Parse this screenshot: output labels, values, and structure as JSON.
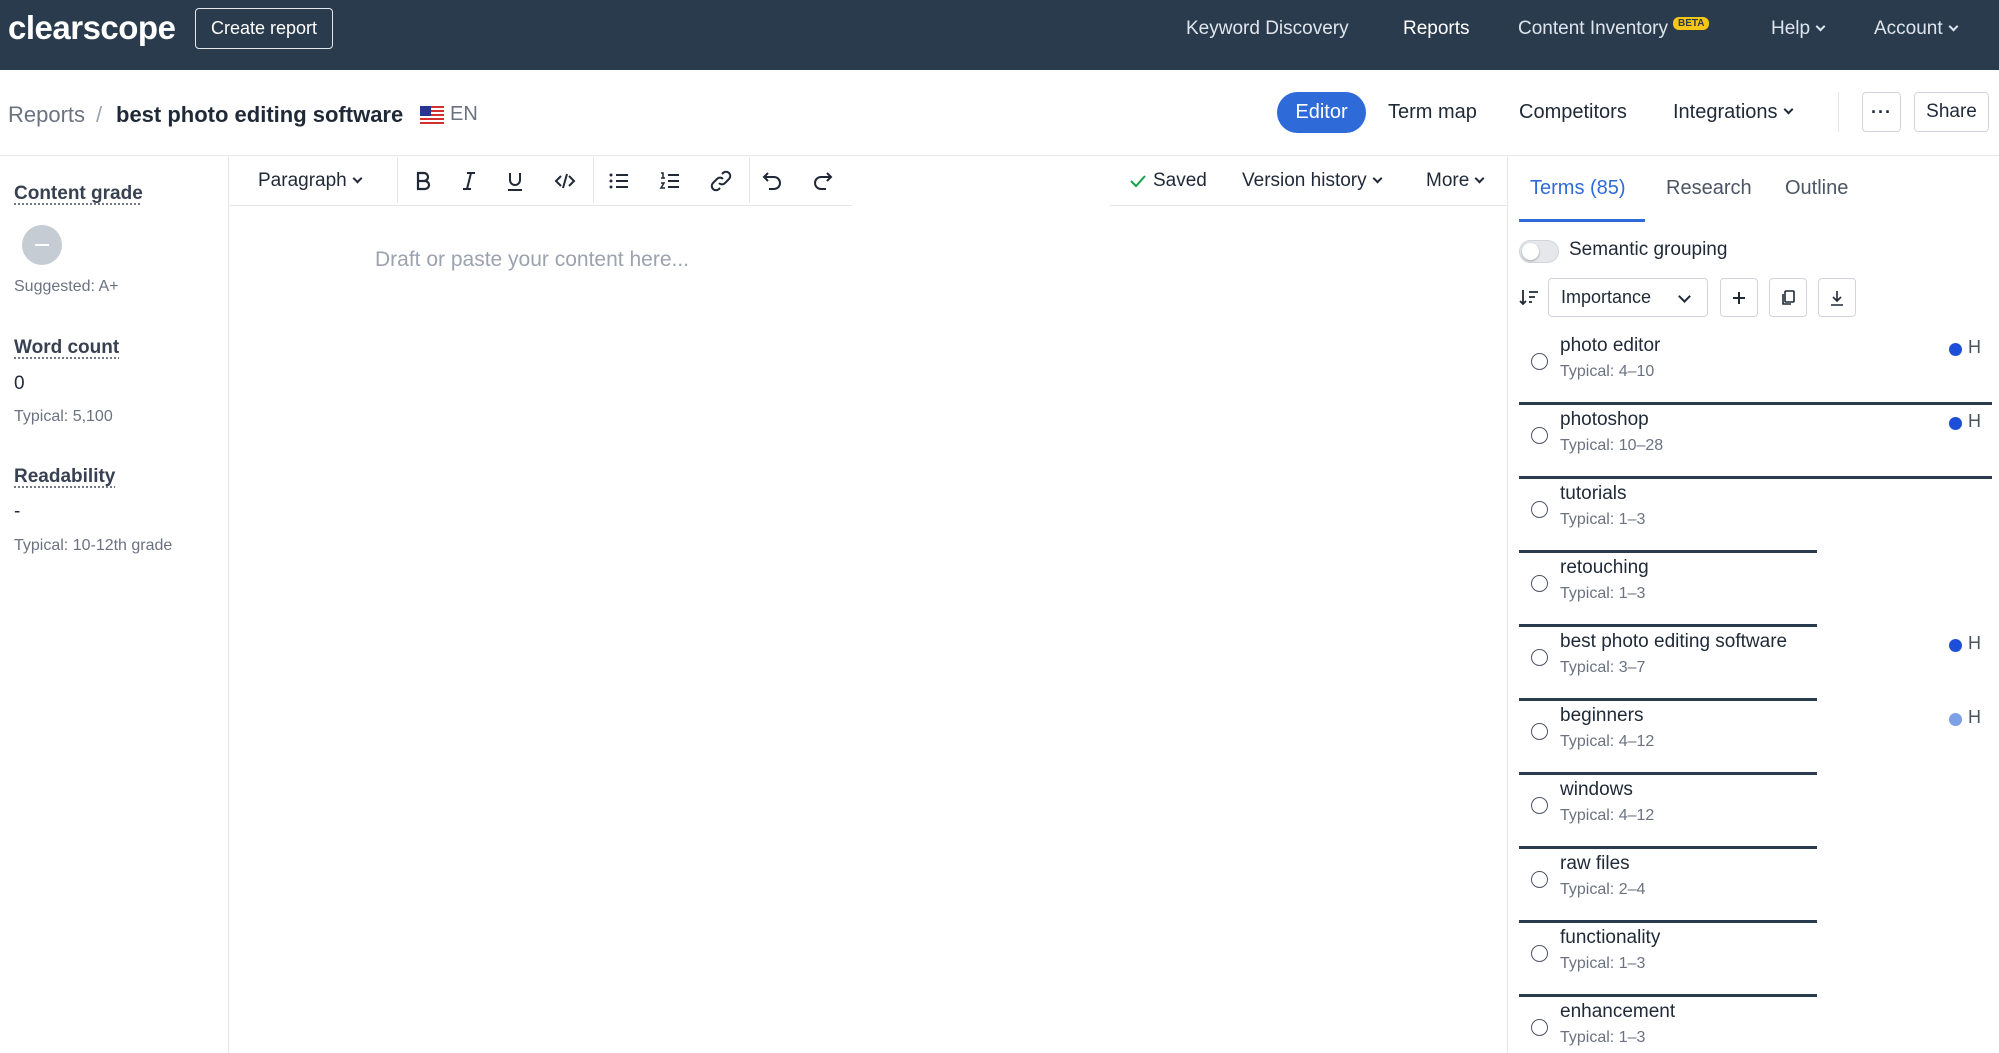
{
  "nav": {
    "logo": "clearscope",
    "create_report": "Create report",
    "keyword_discovery": "Keyword Discovery",
    "reports": "Reports",
    "content_inventory": "Content Inventory",
    "beta": "BETA",
    "help": "Help",
    "account": "Account"
  },
  "header": {
    "breadcrumb_root": "Reports",
    "breadcrumb_sep": "/",
    "title": "best photo editing software",
    "language": "EN",
    "tabs": [
      "Editor",
      "Term map",
      "Competitors",
      "Integrations"
    ],
    "more": "···",
    "share": "Share"
  },
  "metrics": {
    "content_grade_label": "Content grade",
    "content_grade_suggested": "Suggested: A+",
    "word_count_label": "Word count",
    "word_count_value": "0",
    "word_count_typical": "Typical: 5,100",
    "readability_label": "Readability",
    "readability_value": "-",
    "readability_typical": "Typical: 10-12th grade"
  },
  "editor": {
    "block_type": "Paragraph",
    "saved": "Saved",
    "version_history": "Version history",
    "more": "More",
    "placeholder": "Draft or paste your content here..."
  },
  "panel": {
    "tabs": [
      "Terms (85)",
      "Research",
      "Outline"
    ],
    "semantic_grouping": "Semantic grouping",
    "sort_select": "Importance",
    "terms": [
      {
        "name": "photo editor",
        "typical": "Typical: 4–10",
        "heading": "H",
        "importance": 1.0,
        "dot": "#1d4ed8"
      },
      {
        "name": "photoshop",
        "typical": "Typical: 10–28",
        "heading": "H",
        "importance": 1.0,
        "dot": "#1d4ed8"
      },
      {
        "name": "tutorials",
        "typical": "Typical: 1–3",
        "heading": "",
        "importance": 0.63,
        "dot": ""
      },
      {
        "name": "retouching",
        "typical": "Typical: 1–3",
        "heading": "",
        "importance": 0.63,
        "dot": ""
      },
      {
        "name": "best photo editing software",
        "typical": "Typical: 3–7",
        "heading": "H",
        "importance": 0.63,
        "dot": "#1d4ed8"
      },
      {
        "name": "beginners",
        "typical": "Typical: 4–12",
        "heading": "H",
        "importance": 0.63,
        "dot": "#7c9fe6"
      },
      {
        "name": "windows",
        "typical": "Typical: 4–12",
        "heading": "",
        "importance": 0.63,
        "dot": ""
      },
      {
        "name": "raw files",
        "typical": "Typical: 2–4",
        "heading": "",
        "importance": 0.63,
        "dot": ""
      },
      {
        "name": "functionality",
        "typical": "Typical: 1–3",
        "heading": "",
        "importance": 0.63,
        "dot": ""
      },
      {
        "name": "enhancement",
        "typical": "Typical: 1–3",
        "heading": "",
        "importance": 0.63,
        "dot": ""
      }
    ]
  },
  "colors": {
    "nav_bg": "#2a3b4d",
    "accent": "#2f6bd8",
    "beta": "#f5c518",
    "saved_check": "#16a34a"
  }
}
